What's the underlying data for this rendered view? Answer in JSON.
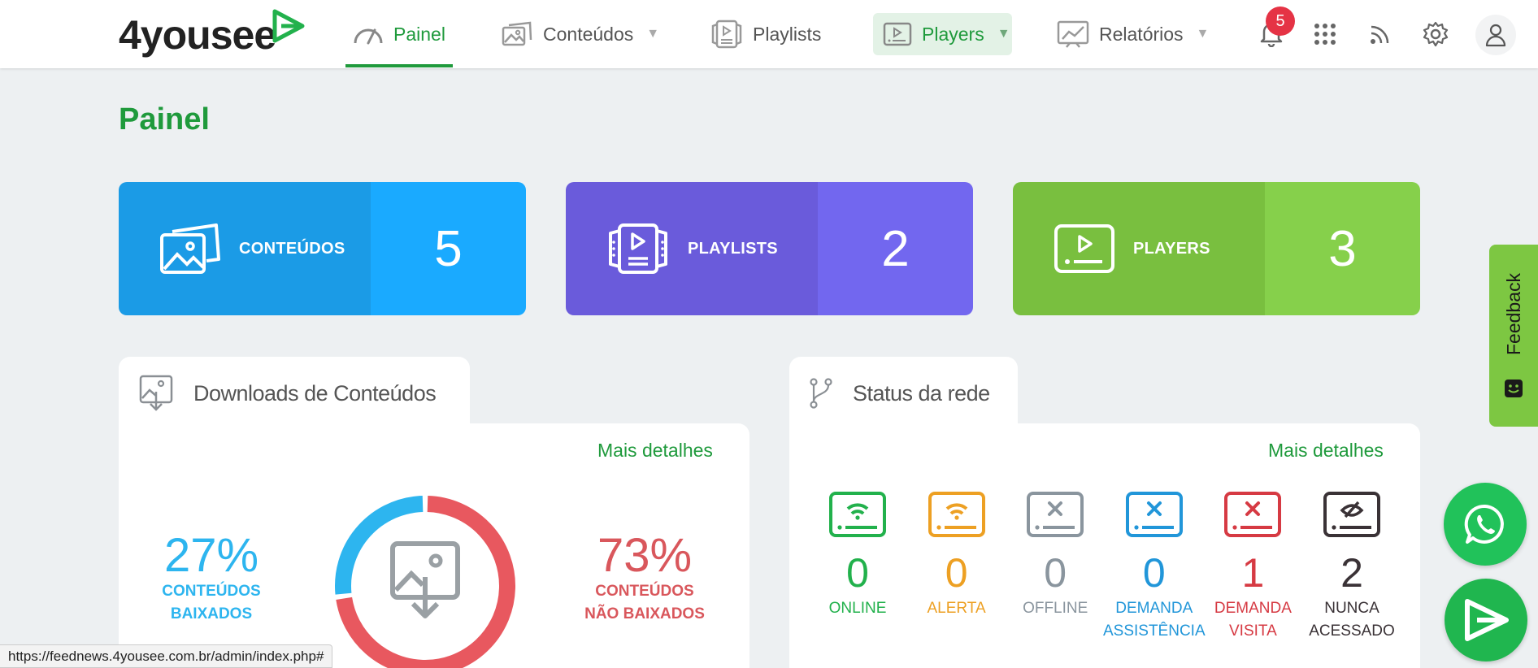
{
  "nav": {
    "brand": "4yousee",
    "items": [
      {
        "label": "Painel",
        "icon": "speedometer-icon"
      },
      {
        "label": "Conteúdos",
        "icon": "images-icon"
      },
      {
        "label": "Playlists",
        "icon": "playlist-icon"
      },
      {
        "label": "Players",
        "icon": "player-icon"
      },
      {
        "label": "Relatórios",
        "icon": "chart-icon"
      }
    ],
    "notifications_count": "5"
  },
  "page": {
    "title": "Painel"
  },
  "cards": [
    {
      "label": "CONTEÚDOS",
      "value": "5",
      "color_left": "#1b9be6",
      "color_right": "#1aaaff"
    },
    {
      "label": "PLAYLISTS",
      "value": "2",
      "color_left": "#6a5bdb",
      "color_right": "#7267ef"
    },
    {
      "label": "PLAYERS",
      "value": "3",
      "color_left": "#79bf3f",
      "color_right": "#86d04b"
    }
  ],
  "downloads": {
    "title": "Downloads de Conteúdos",
    "more": "Mais detalhes",
    "downloaded_pct": "27%",
    "downloaded_label_1": "CONTEÚDOS",
    "downloaded_label_2": "BAIXADOS",
    "not_downloaded_pct": "73%",
    "not_downloaded_label_1": "CONTEÚDOS",
    "not_downloaded_label_2": "NÃO BAIXADOS",
    "downloaded_fraction": 0.27,
    "colors": {
      "downloaded": "#2db5ef",
      "not_downloaded": "#e8585f"
    }
  },
  "network": {
    "title": "Status da rede",
    "more": "Mais detalhes",
    "items": [
      {
        "count": "0",
        "label1": "ONLINE",
        "label2": "",
        "color": "#22b14c"
      },
      {
        "count": "0",
        "label1": "ALERTA",
        "label2": "",
        "color": "#eda023"
      },
      {
        "count": "0",
        "label1": "OFFLINE",
        "label2": "",
        "color": "#8a959e"
      },
      {
        "count": "0",
        "label1": "DEMANDA",
        "label2": "ASSISTÊNCIA",
        "color": "#2196d9"
      },
      {
        "count": "1",
        "label1": "DEMANDA",
        "label2": "VISITA",
        "color": "#d63a43"
      },
      {
        "count": "2",
        "label1": "NUNCA",
        "label2": "ACESSADO",
        "color": "#3a3236"
      }
    ]
  },
  "feedback": {
    "label": "Feedback"
  },
  "statusbar": {
    "url": "https://feednews.4yousee.com.br/admin/index.php#"
  }
}
